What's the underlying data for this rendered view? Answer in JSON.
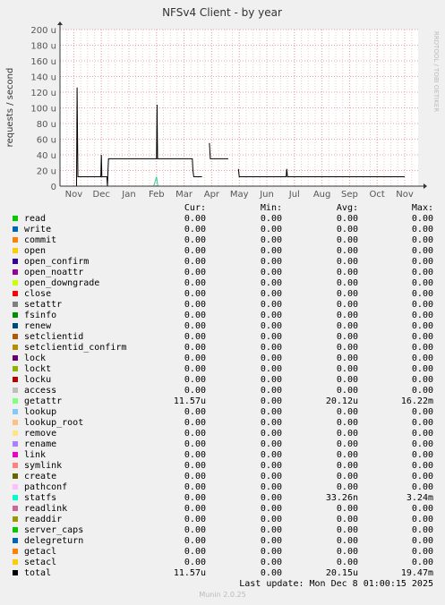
{
  "chart_data": {
    "type": "line",
    "title": "NFSv4 Client - by year",
    "ylabel": "requests / second",
    "side_label": "RRDTOOL / TOBI OETIKER",
    "ylim": [
      0,
      200
    ],
    "yticks": [
      "0",
      "20 u",
      "40 u",
      "60 u",
      "80 u",
      "100 u",
      "120 u",
      "140 u",
      "160 u",
      "180 u",
      "200 u"
    ],
    "ytick_values": [
      0,
      20,
      40,
      60,
      80,
      100,
      120,
      140,
      160,
      180,
      200
    ],
    "x_ticks": [
      "Nov",
      "Dec",
      "Jan",
      "Feb",
      "Mar",
      "Apr",
      "May",
      "Jun",
      "Jul",
      "Aug",
      "Sep",
      "Oct",
      "Nov"
    ],
    "x_unit": "months (Oct 2024 – Dec 2025)",
    "grid": true,
    "series": [
      {
        "name": "total",
        "color": "#000000",
        "points": [
          [
            1.1,
            0
          ],
          [
            1.12,
            126
          ],
          [
            1.15,
            12
          ],
          [
            1.98,
            12
          ],
          [
            2.0,
            40
          ],
          [
            2.02,
            12
          ],
          [
            2.2,
            12
          ],
          [
            2.22,
            0
          ],
          [
            2.24,
            20
          ],
          [
            2.26,
            35
          ],
          [
            2.28,
            35
          ],
          [
            4.0,
            35
          ],
          [
            4.02,
            104
          ],
          [
            4.04,
            35
          ],
          [
            5.3,
            35
          ],
          [
            5.32,
            20
          ],
          [
            5.35,
            12
          ],
          [
            5.65,
            12
          ],
          [
            5.67,
            null
          ],
          [
            5.9,
            null
          ],
          [
            5.92,
            55
          ],
          [
            5.95,
            35
          ],
          [
            6.6,
            35
          ],
          [
            6.62,
            null
          ],
          [
            6.95,
            null
          ],
          [
            6.97,
            22
          ],
          [
            7.0,
            12
          ],
          [
            8.7,
            12
          ],
          [
            8.72,
            22
          ],
          [
            8.75,
            12
          ],
          [
            13.0,
            12
          ]
        ]
      },
      {
        "name": "statfs",
        "color": "#33cc99",
        "points": [
          [
            3.9,
            0
          ],
          [
            4.0,
            12
          ],
          [
            4.05,
            0
          ]
        ]
      }
    ],
    "legend": {
      "headers": [
        "Cur:",
        "Min:",
        "Avg:",
        "Max:"
      ],
      "rows": [
        {
          "name": "read",
          "color": "#00cc00",
          "cur": "0.00",
          "min": "0.00",
          "avg": "0.00",
          "max": "0.00"
        },
        {
          "name": "write",
          "color": "#0066b3",
          "cur": "0.00",
          "min": "0.00",
          "avg": "0.00",
          "max": "0.00"
        },
        {
          "name": "commit",
          "color": "#ff8000",
          "cur": "0.00",
          "min": "0.00",
          "avg": "0.00",
          "max": "0.00"
        },
        {
          "name": "open",
          "color": "#ffcc00",
          "cur": "0.00",
          "min": "0.00",
          "avg": "0.00",
          "max": "0.00"
        },
        {
          "name": "open_confirm",
          "color": "#330099",
          "cur": "0.00",
          "min": "0.00",
          "avg": "0.00",
          "max": "0.00"
        },
        {
          "name": "open_noattr",
          "color": "#990099",
          "cur": "0.00",
          "min": "0.00",
          "avg": "0.00",
          "max": "0.00"
        },
        {
          "name": "open_downgrade",
          "color": "#ccff00",
          "cur": "0.00",
          "min": "0.00",
          "avg": "0.00",
          "max": "0.00"
        },
        {
          "name": "close",
          "color": "#ff0000",
          "cur": "0.00",
          "min": "0.00",
          "avg": "0.00",
          "max": "0.00"
        },
        {
          "name": "setattr",
          "color": "#808080",
          "cur": "0.00",
          "min": "0.00",
          "avg": "0.00",
          "max": "0.00"
        },
        {
          "name": "fsinfo",
          "color": "#008f00",
          "cur": "0.00",
          "min": "0.00",
          "avg": "0.00",
          "max": "0.00"
        },
        {
          "name": "renew",
          "color": "#00487d",
          "cur": "0.00",
          "min": "0.00",
          "avg": "0.00",
          "max": "0.00"
        },
        {
          "name": "setclientid",
          "color": "#b35a00",
          "cur": "0.00",
          "min": "0.00",
          "avg": "0.00",
          "max": "0.00"
        },
        {
          "name": "setclientid_confirm",
          "color": "#b38f00",
          "cur": "0.00",
          "min": "0.00",
          "avg": "0.00",
          "max": "0.00"
        },
        {
          "name": "lock",
          "color": "#6b006b",
          "cur": "0.00",
          "min": "0.00",
          "avg": "0.00",
          "max": "0.00"
        },
        {
          "name": "lockt",
          "color": "#8fb300",
          "cur": "0.00",
          "min": "0.00",
          "avg": "0.00",
          "max": "0.00"
        },
        {
          "name": "locku",
          "color": "#b30000",
          "cur": "0.00",
          "min": "0.00",
          "avg": "0.00",
          "max": "0.00"
        },
        {
          "name": "access",
          "color": "#bebebe",
          "cur": "0.00",
          "min": "0.00",
          "avg": "0.00",
          "max": "0.00"
        },
        {
          "name": "getattr",
          "color": "#80ff80",
          "cur": "11.57u",
          "min": "0.00",
          "avg": "20.12u",
          "max": "16.22m"
        },
        {
          "name": "lookup",
          "color": "#80c9ff",
          "cur": "0.00",
          "min": "0.00",
          "avg": "0.00",
          "max": "0.00"
        },
        {
          "name": "lookup_root",
          "color": "#ffc080",
          "cur": "0.00",
          "min": "0.00",
          "avg": "0.00",
          "max": "0.00"
        },
        {
          "name": "remove",
          "color": "#ffe680",
          "cur": "0.00",
          "min": "0.00",
          "avg": "0.00",
          "max": "0.00"
        },
        {
          "name": "rename",
          "color": "#aa80ff",
          "cur": "0.00",
          "min": "0.00",
          "avg": "0.00",
          "max": "0.00"
        },
        {
          "name": "link",
          "color": "#ee00cc",
          "cur": "0.00",
          "min": "0.00",
          "avg": "0.00",
          "max": "0.00"
        },
        {
          "name": "symlink",
          "color": "#ff8080",
          "cur": "0.00",
          "min": "0.00",
          "avg": "0.00",
          "max": "0.00"
        },
        {
          "name": "create",
          "color": "#666600",
          "cur": "0.00",
          "min": "0.00",
          "avg": "0.00",
          "max": "0.00"
        },
        {
          "name": "pathconf",
          "color": "#ffbfff",
          "cur": "0.00",
          "min": "0.00",
          "avg": "0.00",
          "max": "0.00"
        },
        {
          "name": "statfs",
          "color": "#00ffcc",
          "cur": "0.00",
          "min": "0.00",
          "avg": "33.26n",
          "max": "3.24m"
        },
        {
          "name": "readlink",
          "color": "#cc6699",
          "cur": "0.00",
          "min": "0.00",
          "avg": "0.00",
          "max": "0.00"
        },
        {
          "name": "readdir",
          "color": "#999900",
          "cur": "0.00",
          "min": "0.00",
          "avg": "0.00",
          "max": "0.00"
        },
        {
          "name": "server_caps",
          "color": "#00cc00",
          "cur": "0.00",
          "min": "0.00",
          "avg": "0.00",
          "max": "0.00"
        },
        {
          "name": "delegreturn",
          "color": "#0066b3",
          "cur": "0.00",
          "min": "0.00",
          "avg": "0.00",
          "max": "0.00"
        },
        {
          "name": "getacl",
          "color": "#ff8000",
          "cur": "0.00",
          "min": "0.00",
          "avg": "0.00",
          "max": "0.00"
        },
        {
          "name": "setacl",
          "color": "#ffcc00",
          "cur": "0.00",
          "min": "0.00",
          "avg": "0.00",
          "max": "0.00"
        },
        {
          "name": "total",
          "color": "#000000",
          "cur": "11.57u",
          "min": "0.00",
          "avg": "20.15u",
          "max": "19.47m"
        }
      ]
    }
  },
  "footer": {
    "last_update": "Last update:  Mon Dec  8 01:00:15 2025",
    "generator": "Munin 2.0.25"
  }
}
